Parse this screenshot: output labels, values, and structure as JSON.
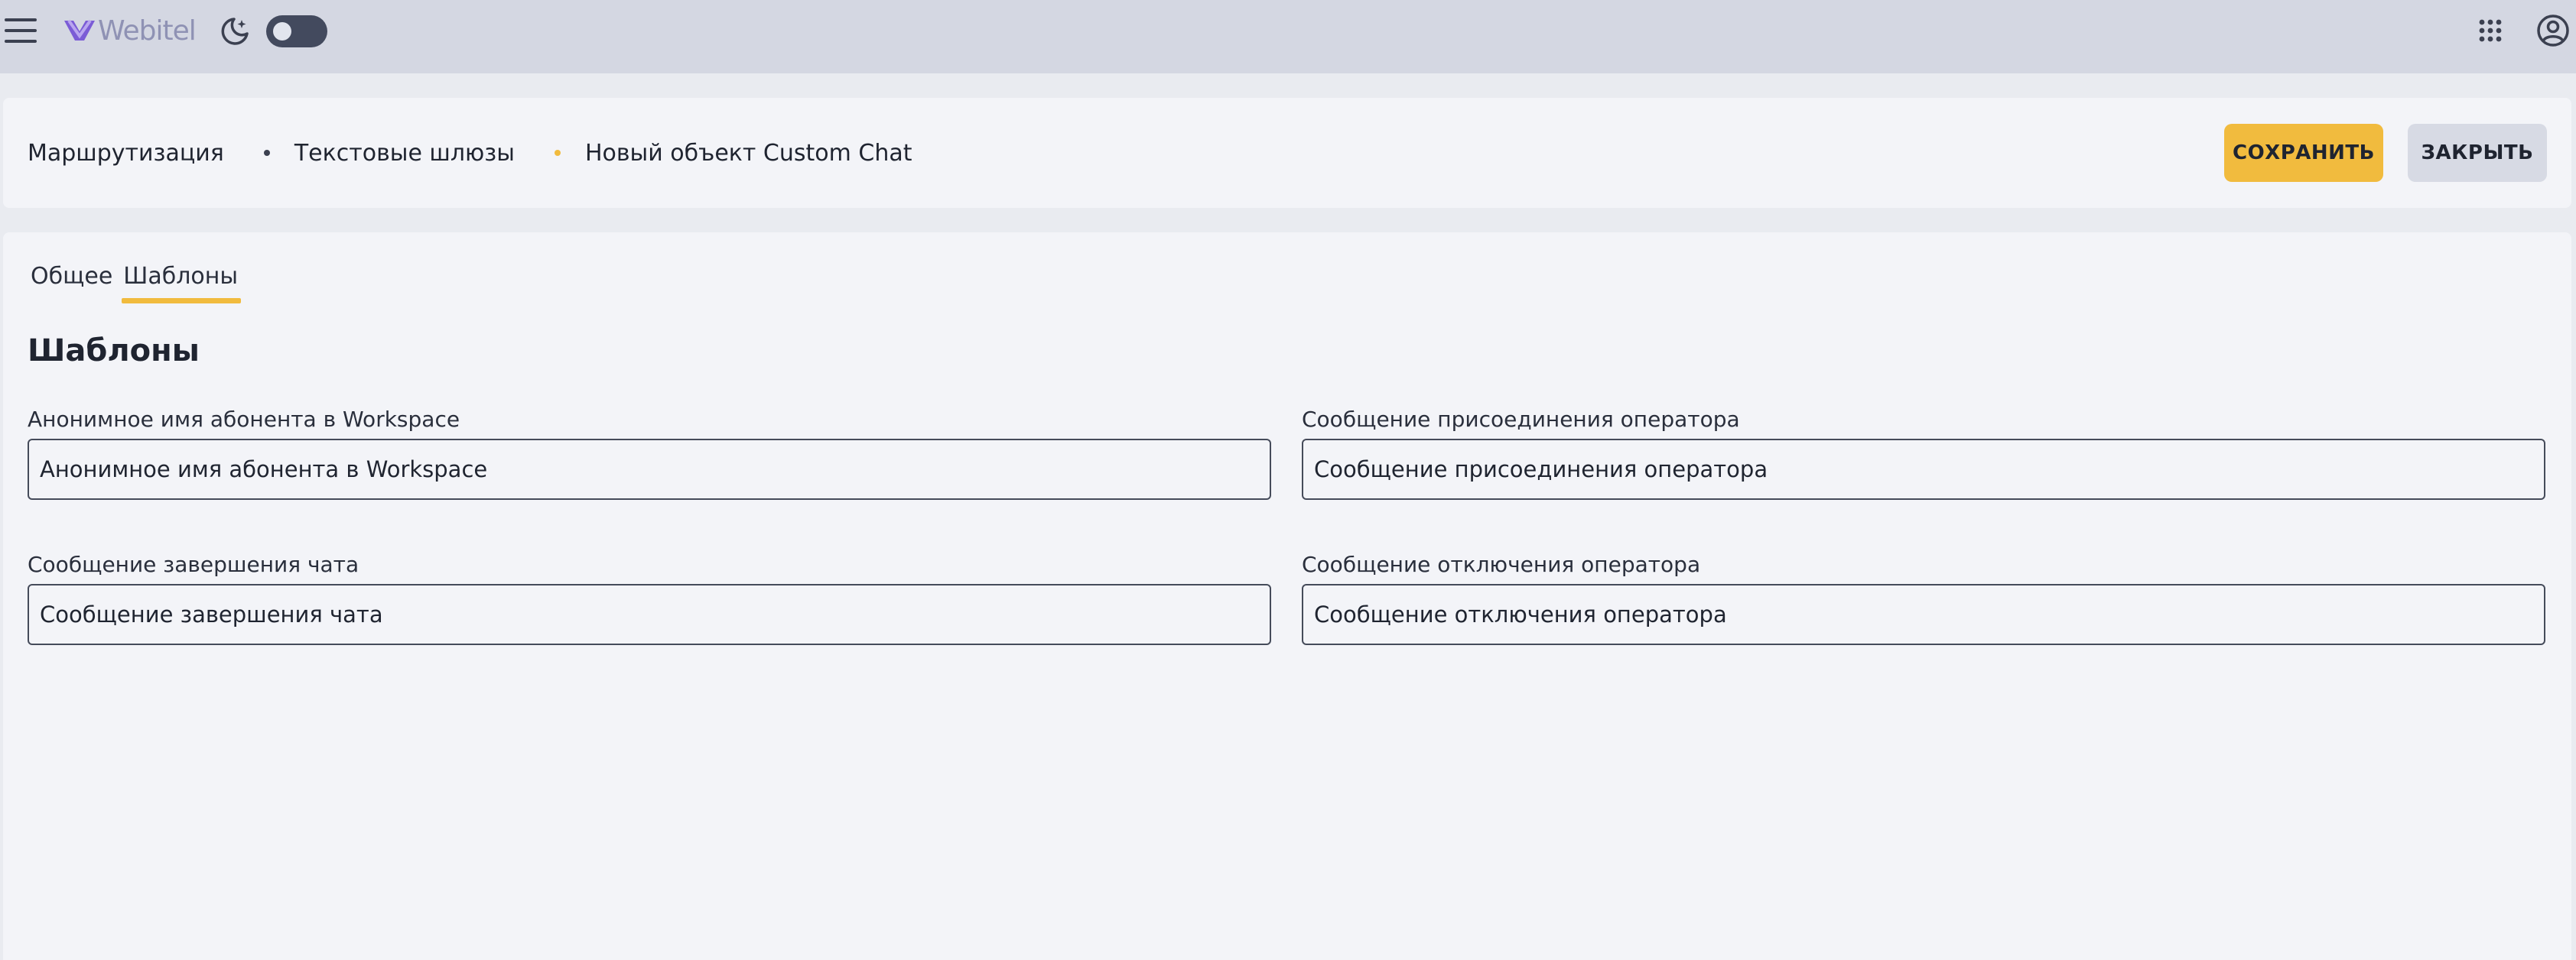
{
  "app": {
    "logo_text": "Webitel",
    "logo_color": "#7b5cd6"
  },
  "colors": {
    "accent": "#f1bb3e",
    "appbar": "#d4d7e2",
    "toggle": "#434a5e",
    "breadcrumb_dot_1": "#3b4050",
    "breadcrumb_dot_2": "#f1bb3e"
  },
  "icons": {
    "menu": "hamburger-menu-icon",
    "theme": "moon-icon",
    "apps": "apps-grid-icon",
    "account": "account-icon"
  },
  "breadcrumb": [
    {
      "label": "Маршрутизация"
    },
    {
      "label": "Текстовые шлюзы"
    },
    {
      "label": "Новый объект Custom Chat"
    }
  ],
  "actions": {
    "save_label": "СОХРАНИТЬ",
    "close_label": "ЗАКРЫТЬ"
  },
  "tabs": [
    {
      "label": "Общее",
      "active": false
    },
    {
      "label": "Шаблоны",
      "active": true
    }
  ],
  "section": {
    "title": "Шаблоны"
  },
  "fields": [
    {
      "label": "Анонимное имя абонента в Workspace",
      "placeholder": "Анонимное имя абонента в Workspace",
      "value": ""
    },
    {
      "label": "Сообщение присоединения оператора",
      "placeholder": "Сообщение присоединения оператора",
      "value": ""
    },
    {
      "label": "Сообщение завершения чата",
      "placeholder": "Сообщение завершения чата",
      "value": ""
    },
    {
      "label": "Сообщение отключения оператора",
      "placeholder": "Сообщение отключения оператора",
      "value": ""
    }
  ]
}
